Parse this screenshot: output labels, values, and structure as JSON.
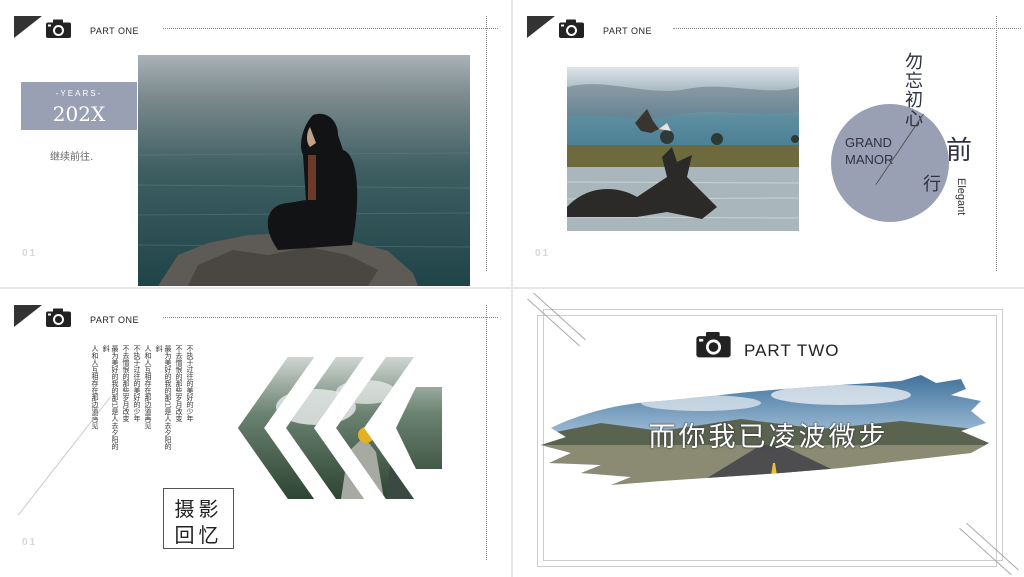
{
  "slide1": {
    "part_label": "PART ONE",
    "years_label": "-YEARS-",
    "year": "202X",
    "subtitle": "继续前往.",
    "page_number": "01"
  },
  "slide2": {
    "part_label": "PART ONE",
    "vertical_title": "勿忘初心",
    "char_qian": "前",
    "char_xing": "行",
    "grand_manor": "GRAND\nMANOR",
    "elegant": "Elegant",
    "page_number": "01"
  },
  "slide3": {
    "part_label": "PART ONE",
    "poem_lines": [
      "不执于过往的美好的少年",
      "不去憎恨的那些岁月改变",
      "最为美好的我的那已是人去夕阳的斜",
      "人和人互相存在那边道再见",
      "不执于过往的美好的少年",
      "不去憎恨的那些岁月改变",
      "最为美好的我的那已是人去夕阳的斜",
      "人和人互相存在那边道再见"
    ],
    "box_line1": "摄影",
    "box_line2": "回忆",
    "page_number": "01"
  },
  "slide4": {
    "part_label": "PART TWO",
    "brush_title": "而你我已凌波微步"
  },
  "colors": {
    "accent": "#9aa0b3",
    "dark": "#333333"
  }
}
